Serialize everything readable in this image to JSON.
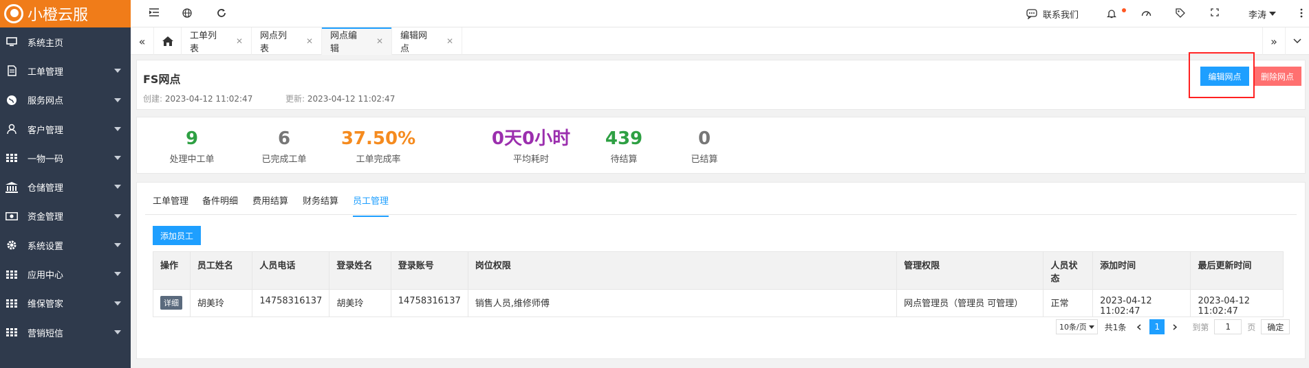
{
  "brand": {
    "name": "小橙云服",
    "accent": "#f07c19"
  },
  "sidebar": {
    "items": [
      {
        "label": "系统主页",
        "icon": "monitor-icon"
      },
      {
        "label": "工单管理",
        "icon": "document-icon"
      },
      {
        "label": "服务网点",
        "icon": "globe-icon"
      },
      {
        "label": "客户管理",
        "icon": "user-icon"
      },
      {
        "label": "一物一码",
        "icon": "grid-icon"
      },
      {
        "label": "仓储管理",
        "icon": "bank-icon"
      },
      {
        "label": "资金管理",
        "icon": "money-icon"
      },
      {
        "label": "系统设置",
        "icon": "gear-icon"
      },
      {
        "label": "应用中心",
        "icon": "grid-icon"
      },
      {
        "label": "维保管家",
        "icon": "grid-icon"
      },
      {
        "label": "营销短信",
        "icon": "grid-icon"
      }
    ]
  },
  "topbar": {
    "contact": "联系我们",
    "user": "李涛"
  },
  "tabs": [
    {
      "label": "工单列表"
    },
    {
      "label": "网点列表"
    },
    {
      "label": "网点编辑"
    },
    {
      "label": "编辑网点"
    }
  ],
  "header": {
    "title": "FS网点",
    "created_label": "创建:",
    "created": "2023-04-12 11:02:47",
    "updated_label": "更新:",
    "updated": "2023-04-12 11:02:47",
    "edit_button": "编辑网点",
    "delete_button": "删除网点"
  },
  "stats": [
    {
      "value": "9",
      "label": "处理中工单",
      "color": "#2ea043"
    },
    {
      "value": "6",
      "label": "已完成工单",
      "color": "#777777"
    },
    {
      "value": "37.50%",
      "label": "工单完成率",
      "color": "#f58b1f"
    },
    {
      "value": "0天0小时",
      "label": "平均耗时",
      "color": "#9b2fae"
    },
    {
      "value": "439",
      "label": "待结算",
      "color": "#2ea043"
    },
    {
      "value": "0",
      "label": "已结算",
      "color": "#777777"
    }
  ],
  "subtabs": [
    {
      "label": "工单管理"
    },
    {
      "label": "备件明细"
    },
    {
      "label": "费用结算"
    },
    {
      "label": "财务结算"
    },
    {
      "label": "员工管理"
    }
  ],
  "add_button": "添加员工",
  "table": {
    "headers": [
      "操作",
      "员工姓名",
      "人员电话",
      "登录姓名",
      "登录账号",
      "岗位权限",
      "管理权限",
      "人员状态",
      "添加时间",
      "最后更新时间"
    ],
    "rows": [
      {
        "action": "详细",
        "name": "胡美玲",
        "phone": "14758316137",
        "login_name": "胡美玲",
        "login_account": "14758316137",
        "positions": "销售人员,维修师傅",
        "admin": "网点管理员（管理员 可管理）",
        "status": "正常",
        "added": "2023-04-12 11:02:47",
        "updated": "2023-04-12 11:02:47"
      }
    ]
  },
  "pager": {
    "page_size": "10条/页",
    "total": "共1条",
    "current": "1",
    "goto_label": "到第",
    "goto_value": "1",
    "page_unit": "页",
    "confirm": "确定"
  }
}
